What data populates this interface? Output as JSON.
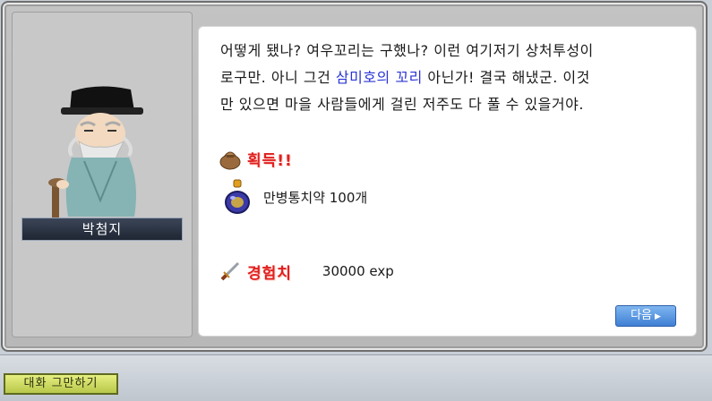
{
  "npc": {
    "name": "박첨지"
  },
  "dialog": {
    "line1": "어떻게 됐나? 여우꼬리는 구했나? 이런 여기저기 상처투성이",
    "line2_before": "로구만. 아니 그건 ",
    "line2_highlight": "삼미호의 꼬리",
    "line2_after": " 아닌가! 결국 해냈군. 이것",
    "line3": "만 있으면 마을 사람들에게 걸린 저주도 다 풀 수 있을거야."
  },
  "reward": {
    "acquire_label": "획득!!",
    "item_name": "만병통치약 100개",
    "exp_label": "경험치",
    "exp_value": "30000 exp"
  },
  "buttons": {
    "next_label": "다음",
    "end_chat_label": "대화 그만하기"
  },
  "icons": {
    "acquire": "bag-icon",
    "item": "potion-icon",
    "exp": "sword-icon",
    "next": "arrow-right-icon"
  },
  "colors": {
    "highlight_text": "#2a34d6",
    "reward_label": "#e02020",
    "next_button": "#3f7fd4",
    "end_chat_button": "#b8c84a"
  }
}
